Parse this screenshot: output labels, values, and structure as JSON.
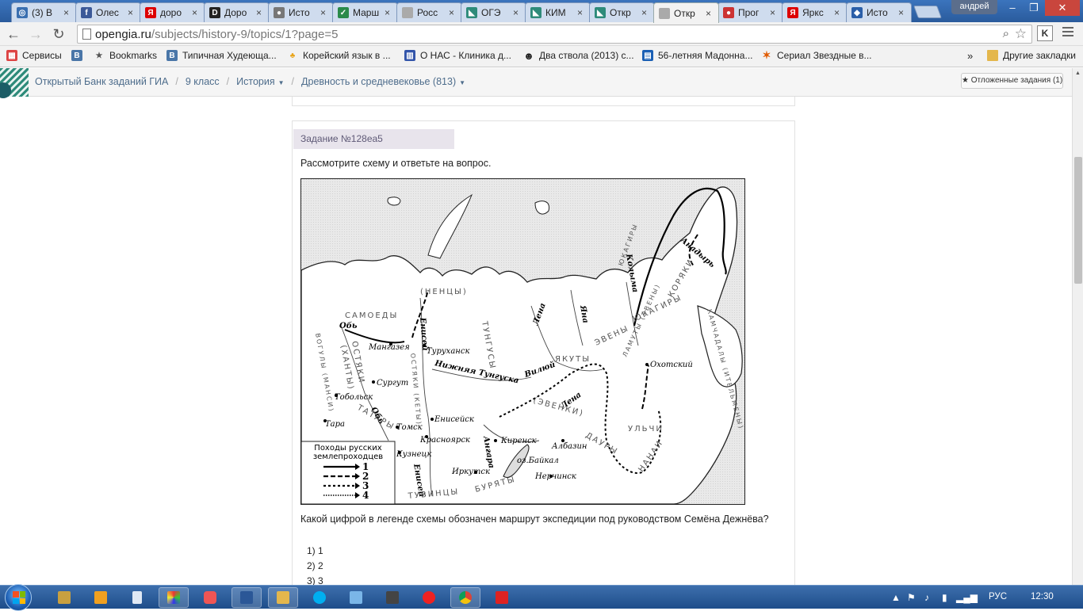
{
  "browser": {
    "tabs": [
      {
        "title": "(3) В",
        "color": "#3a6fb0",
        "glyph": "◎"
      },
      {
        "title": "Олес",
        "color": "#3b5998",
        "glyph": "f"
      },
      {
        "title": "доро",
        "color": "#d00",
        "glyph": "Я"
      },
      {
        "title": "Доро",
        "color": "#222",
        "glyph": "D"
      },
      {
        "title": "Исто",
        "color": "#777",
        "glyph": "●"
      },
      {
        "title": "Марш",
        "color": "#2a8a4a",
        "glyph": "✓"
      },
      {
        "title": "Росс",
        "color": "#aaa",
        "glyph": ""
      },
      {
        "title": "ОГЭ",
        "color": "#2e8b7a",
        "glyph": "◣"
      },
      {
        "title": "КИМ",
        "color": "#2e8b7a",
        "glyph": "◣"
      },
      {
        "title": "Откр",
        "color": "#2e8b7a",
        "glyph": "◣"
      },
      {
        "title": "Откр",
        "color": "#aaa",
        "glyph": "",
        "active": true
      },
      {
        "title": "Прог",
        "color": "#c33",
        "glyph": "●"
      },
      {
        "title": "Яркс",
        "color": "#d00",
        "glyph": "Я"
      },
      {
        "title": "Исто",
        "color": "#2a5ea8",
        "glyph": "◆"
      }
    ],
    "user_name": "андрей",
    "url_host": "opengia.ru",
    "url_path": "/subjects/history-9/topics/1?page=5",
    "extension_label": "K",
    "bookmarks": [
      {
        "label": "Сервисы",
        "color": "#d44",
        "glyph": "▦"
      },
      {
        "label": "",
        "color": "#4a76a8",
        "glyph": "B"
      },
      {
        "label": "Bookmarks",
        "color": "#555",
        "glyph": "★"
      },
      {
        "label": "Типичная Худеюща...",
        "color": "#4a76a8",
        "glyph": "B"
      },
      {
        "label": "Корейский язык в ...",
        "color": "#e8a317",
        "glyph": "♣"
      },
      {
        "label": "О НАС - Клиника д...",
        "color": "#3355aa",
        "glyph": "▥"
      },
      {
        "label": "Два ствола (2013) с...",
        "color": "#222",
        "glyph": "☻"
      },
      {
        "label": "56-летняя Мадонна...",
        "color": "#1a5fb4",
        "glyph": "▤"
      },
      {
        "label": "Сериал Звездные в...",
        "color": "#e05a00",
        "glyph": "✶"
      }
    ],
    "bookmarks_more": "»",
    "other_bookmarks": "Другие закладки"
  },
  "site": {
    "breadcrumbs": [
      "Открытый Банк заданий ГИА",
      "9 класс",
      "История",
      "Древность и средневековье (813)"
    ],
    "deferred_tasks": "Отложенные задания (1)"
  },
  "task": {
    "header": "Задание №128ea5",
    "prompt": "Рассмотрите схему и ответьте на вопрос.",
    "question": "Какой цифрой в легенде схемы обозначен маршрут экспедиции под руководством Семёна Дежнёва?",
    "options": [
      "1) 1",
      "2) 2",
      "3) 3"
    ]
  },
  "map": {
    "legend_title_1": "Походы русских",
    "legend_title_2": "землепроходцев",
    "legend_numbers": [
      "1",
      "2",
      "3",
      "4"
    ],
    "cities": [
      "Мангазея",
      "Туруханск",
      "Сургут",
      "Тобольск",
      "Тара",
      "Томск",
      "Енисейск",
      "Красноярск",
      "Кузнецк",
      "Иркутск",
      "Киренск",
      "Албазин",
      "Нерчинск",
      "Охотский",
      "оз.Байкал"
    ],
    "rivers": [
      "Обь",
      "Енисей",
      "Нижняя Тунгуска",
      "Вилюй",
      "Лена",
      "Яна",
      "Колыма",
      "Анадырь",
      "Ангара",
      "Обь",
      "Енисей",
      "Лена"
    ],
    "peoples": [
      "САМОЕДЫ",
      "(НЕНЦЫ)",
      "ОСТЯКИ",
      "(ХАНТЫ)",
      "ВОГУЛЫ (МАНСИ)",
      "ТАТАРЫ",
      "ОСТЯКИ (КЕТЫ)",
      "ТУНГУСЫ",
      "ЯКУТЫ",
      "(ЭВЕНКИ)",
      "ЭВЕНЫ",
      "ЮКАГИРЫ",
      "ЛАМУТЫ (ЭВЕНЫ)",
      "КОРЯКИ",
      "ЮКАГИРЫ",
      "КАМЧАДАЛЫ (ИТЕЛЬМЕНЫ)",
      "ДАУРЫ",
      "УЛЬЧИ",
      "НАНАИ",
      "БУРЯТЫ",
      "ТУВИНЦЫ"
    ]
  },
  "taskbar": {
    "language": "РУС",
    "time": "12:30"
  }
}
